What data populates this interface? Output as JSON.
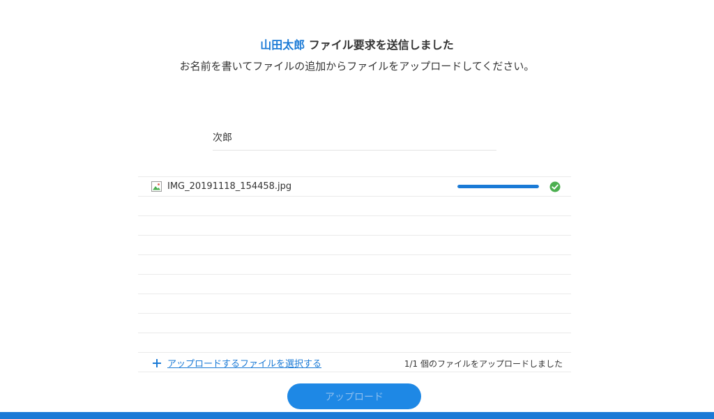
{
  "header": {
    "sender_name": "山田太郎",
    "title_suffix": " ファイル要求を送信しました",
    "subtitle": "お名前を書いてファイルの追加からファイルをアップロードしてください。"
  },
  "name_input": {
    "value": "次郎"
  },
  "files": [
    {
      "name": "IMG_20191118_154458.jpg",
      "icon": "image-file-icon",
      "progress_percent": 100,
      "status_icon": "check-circle-icon"
    }
  ],
  "footer": {
    "add_link_label": "アップロードするファイルを選択する",
    "status_text": "1/1 個のファイルをアップロードしました"
  },
  "upload_button": {
    "label": "アップロード"
  },
  "colors": {
    "accent": "#1a7ad6",
    "success": "#4caf50",
    "border": "#eaeaea"
  }
}
